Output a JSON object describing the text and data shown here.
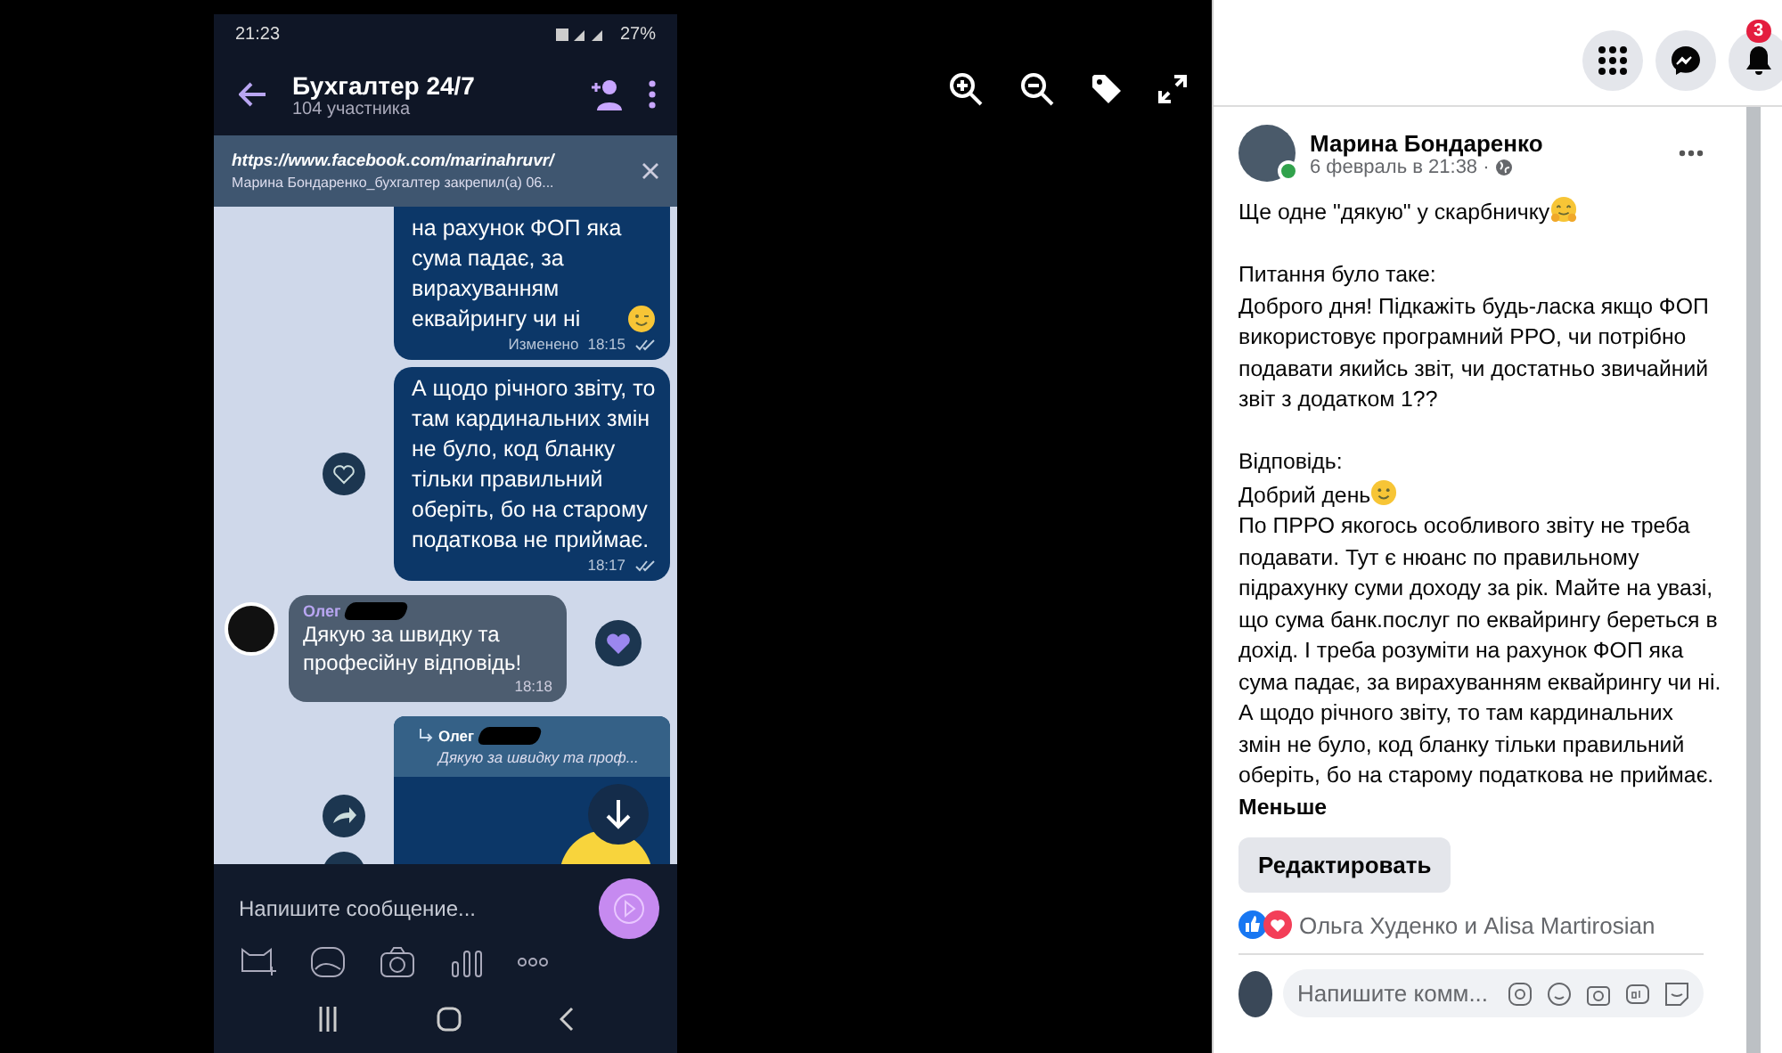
{
  "phone": {
    "status_bar": {
      "time": "21:23",
      "battery": "27%"
    },
    "header": {
      "title": "Бухгалтер 24/7",
      "subtitle": "104 участника"
    },
    "pinned": {
      "link": "https://www.facebook.com/marinahruvr/",
      "text": "Марина Бондаренко_бухгалтер закрепил(а) 06..."
    },
    "messages": [
      {
        "kind": "outgoing",
        "text": "на рахунок ФОП яка сума падає, за вирахуванням еквайрингу чи ні",
        "emoji_wink": true,
        "edited": "Изменено",
        "time": "18:15"
      },
      {
        "kind": "outgoing",
        "text": "А щодо річного звіту, то там кардинальних змін не було, код бланку тільки правильний оберіть, бо на старому податкова не приймає.",
        "time": "18:17"
      },
      {
        "kind": "incoming",
        "author": "Олег",
        "text": "Дякую за швидку та професійну відповідь!",
        "time": "18:18"
      },
      {
        "kind": "reply",
        "author": "Олег",
        "quote": "Дякую за швидку та проф..."
      }
    ],
    "composer": {
      "placeholder": "Напишите сообщение..."
    }
  },
  "topbar": {
    "notifications_badge": "3"
  },
  "post": {
    "author": "Марина Бондаренко",
    "date": "6 февраль в 21:38 ·",
    "sections": [
      [
        {
          "text": "Ще одне \"дякую\" у скарбничку",
          "emoji_hug": true
        }
      ],
      [
        {
          "text": "Питання було таке:"
        },
        {
          "text": "Доброго дня! Підкажіть будь-ласка якщо ФОП використовує програмний РРО, чи потрібно подавати якийсь звіт, чи достатньо звичайний звіт з додатком 1??"
        }
      ],
      [
        {
          "text": "Відповідь:"
        },
        {
          "text": "Добрий день",
          "emoji_smile": true
        },
        {
          "text": "По ПРРО якогось особливого звіту не треба подавати. Тут є нюанс по правильному підрахунку суми доходу за рік. Майте на увазі, що сума банк.послуг по еквайрингу береться в дохід. І треба розуміти на рахунок ФОП яка сума падає, за вирахуванням еквайрингу чи ні. А щодо річного звіту, то там кардинальних змін не було, код бланку тільки правильний оберіть, бо на старому податкова не приймає."
        }
      ]
    ],
    "less_link": "Меньше",
    "edit_button": "Редактировать",
    "reactions": "Ольга Худенко и Alisa Martirosian",
    "comment": {
      "placeholder": "Напишите комм..."
    }
  }
}
